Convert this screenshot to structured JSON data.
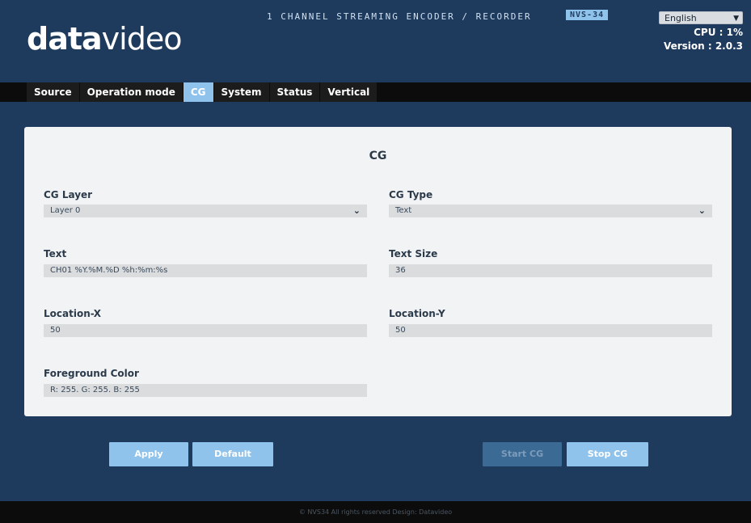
{
  "header": {
    "logo_bold": "data",
    "logo_thin": "video",
    "product_title": "1 CHANNEL STREAMING ENCODER / RECORDER",
    "model": "NVS-34",
    "language": "English",
    "cpu": "CPU : 1%",
    "version": "Version : 2.0.3"
  },
  "tabs": [
    {
      "label": "Source",
      "active": false
    },
    {
      "label": "Operation mode",
      "active": false
    },
    {
      "label": "CG",
      "active": true
    },
    {
      "label": "System",
      "active": false
    },
    {
      "label": "Status",
      "active": false
    },
    {
      "label": "Vertical",
      "active": false
    }
  ],
  "panel": {
    "title": "CG",
    "cg_layer": {
      "label": "CG Layer",
      "value": "Layer 0"
    },
    "cg_type": {
      "label": "CG Type",
      "value": "Text"
    },
    "text": {
      "label": "Text",
      "value": "CH01 %Y.%M.%D %h:%m:%s"
    },
    "text_size": {
      "label": "Text Size",
      "value": "36"
    },
    "location_x": {
      "label": "Location-X",
      "value": "50"
    },
    "location_y": {
      "label": "Location-Y",
      "value": "50"
    },
    "foreground_color": {
      "label": "Foreground Color",
      "value": "R: 255. G: 255. B: 255"
    }
  },
  "buttons": {
    "apply": "Apply",
    "default": "Default",
    "start_cg": "Start CG",
    "stop_cg": "Stop CG"
  },
  "footer": "© NVS34 All rights reserved Design: Datavideo",
  "colors": {
    "background": "#1e3a5c",
    "accent": "#8fc3ec",
    "navbar": "#0c0c0c",
    "panel": "#f2f3f4"
  }
}
